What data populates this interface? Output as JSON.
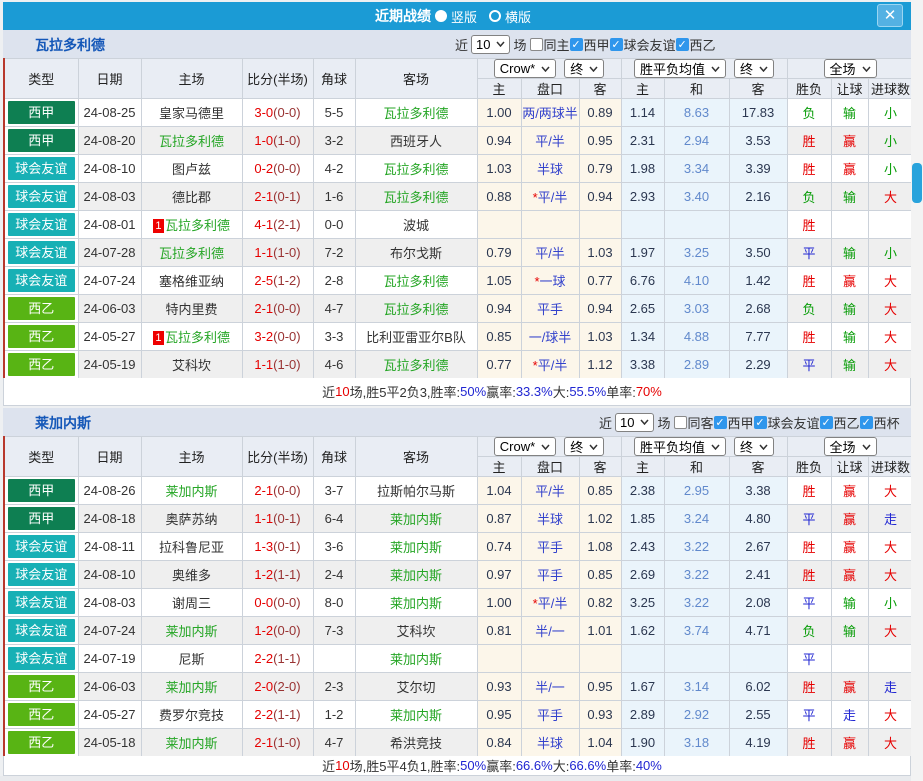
{
  "titlebar": {
    "title": "近期战绩",
    "options": [
      {
        "label": "竖版",
        "selected": true
      },
      {
        "label": "横版",
        "selected": false
      }
    ],
    "close": "✕"
  },
  "dropdowns": {
    "odds_source": "Crow*",
    "odds_time": "终",
    "avg": "胜平负均值",
    "avg_time": "终",
    "scope": "全场"
  },
  "columns": {
    "type": "类型",
    "date": "日期",
    "home": "主场",
    "score": "比分(半场)",
    "corners": "角球",
    "away": "客场",
    "home_odds": "主",
    "handicap": "盘口",
    "away_odds": "客",
    "avg_home": "主",
    "avg_draw": "和",
    "avg_away": "客",
    "result": "胜负",
    "let": "让球",
    "goals": "进球数"
  },
  "league_colors": {
    "西甲": "#0e7f52",
    "球会友谊": "#17b0b5",
    "西乙": "#58b414"
  },
  "status_classes": {
    "胜": "t-red",
    "平": "t-blue",
    "负": "t-green",
    "赢": "t-red",
    "输": "t-green",
    "走": "t-blue",
    "大": "t-red",
    "小": "t-green"
  },
  "appearance": {
    "titlebar_bg": "#1b9bd5",
    "filter_bg": "#dde3ee",
    "accent_blue": "#2f96ec",
    "crow_bg": "#fcf6ea",
    "avg_bg": "#eaf4fb"
  },
  "sections": [
    {
      "team": "瓦拉多利德",
      "filter": {
        "near": "近",
        "count": "10",
        "unit": "场",
        "checkboxes": [
          {
            "label": "同主",
            "checked": false
          },
          {
            "label": "西甲",
            "checked": true
          },
          {
            "label": "球会友谊",
            "checked": true
          },
          {
            "label": "西乙",
            "checked": true
          }
        ]
      },
      "rows": [
        {
          "l": "西甲",
          "d": "24-08-25",
          "h": "皇家马德里",
          "hs": false,
          "hm": "",
          "s": "3-0",
          "sh": "(0-0)",
          "c": "5-5",
          "a": "瓦拉多利德",
          "as": true,
          "am": "",
          "o1": "1.00",
          "o2": "两/两球半",
          "o3": "0.89",
          "m1": "1.14",
          "m2": "8.63",
          "m3": "17.83",
          "r": "负",
          "rl": "输",
          "g": "小"
        },
        {
          "l": "西甲",
          "d": "24-08-20",
          "h": "瓦拉多利德",
          "hs": true,
          "hm": "",
          "s": "1-0",
          "sh": "(1-0)",
          "c": "3-2",
          "a": "西班牙人",
          "as": false,
          "am": "",
          "o1": "0.94",
          "o2": "平/半",
          "o3": "0.95",
          "m1": "2.31",
          "m2": "2.94",
          "m3": "3.53",
          "r": "胜",
          "rl": "赢",
          "g": "小"
        },
        {
          "l": "球会友谊",
          "d": "24-08-10",
          "h": "图卢兹",
          "hs": false,
          "hm": "",
          "s": "0-2",
          "sh": "(0-0)",
          "c": "4-2",
          "a": "瓦拉多利德",
          "as": true,
          "am": "",
          "o1": "1.03",
          "o2": "半球",
          "o3": "0.79",
          "m1": "1.98",
          "m2": "3.34",
          "m3": "3.39",
          "r": "胜",
          "rl": "赢",
          "g": "小"
        },
        {
          "l": "球会友谊",
          "d": "24-08-03",
          "h": "德比郡",
          "hs": false,
          "hm": "",
          "s": "2-1",
          "sh": "(0-1)",
          "c": "1-6",
          "a": "瓦拉多利德",
          "as": true,
          "am": "",
          "o1": "0.88",
          "o2": "*平/半",
          "o3": "0.94",
          "m1": "2.93",
          "m2": "3.40",
          "m3": "2.16",
          "r": "负",
          "rl": "输",
          "g": "大"
        },
        {
          "l": "球会友谊",
          "d": "24-08-01",
          "h": "瓦拉多利德",
          "hs": true,
          "hm": "1",
          "s": "4-1",
          "sh": "(2-1)",
          "c": "0-0",
          "a": "波城",
          "as": false,
          "am": "",
          "o1": "",
          "o2": "",
          "o3": "",
          "m1": "",
          "m2": "",
          "m3": "",
          "r": "胜",
          "rl": "",
          "g": ""
        },
        {
          "l": "球会友谊",
          "d": "24-07-28",
          "h": "瓦拉多利德",
          "hs": true,
          "hm": "",
          "s": "1-1",
          "sh": "(1-0)",
          "c": "7-2",
          "a": "布尔戈斯",
          "as": false,
          "am": "",
          "o1": "0.79",
          "o2": "平/半",
          "o3": "1.03",
          "m1": "1.97",
          "m2": "3.25",
          "m3": "3.50",
          "r": "平",
          "rl": "输",
          "g": "小"
        },
        {
          "l": "球会友谊",
          "d": "24-07-24",
          "h": "塞格维亚纳",
          "hs": false,
          "hm": "",
          "s": "2-5",
          "sh": "(1-2)",
          "c": "2-8",
          "a": "瓦拉多利德",
          "as": true,
          "am": "",
          "o1": "1.05",
          "o2": "*一球",
          "o3": "0.77",
          "m1": "6.76",
          "m2": "4.10",
          "m3": "1.42",
          "r": "胜",
          "rl": "赢",
          "g": "大"
        },
        {
          "l": "西乙",
          "d": "24-06-03",
          "h": "特内里费",
          "hs": false,
          "hm": "",
          "s": "2-1",
          "sh": "(0-0)",
          "c": "4-7",
          "a": "瓦拉多利德",
          "as": true,
          "am": "",
          "o1": "0.94",
          "o2": "平手",
          "o3": "0.94",
          "m1": "2.65",
          "m2": "3.03",
          "m3": "2.68",
          "r": "负",
          "rl": "输",
          "g": "大"
        },
        {
          "l": "西乙",
          "d": "24-05-27",
          "h": "瓦拉多利德",
          "hs": true,
          "hm": "1",
          "s": "3-2",
          "sh": "(0-0)",
          "c": "3-3",
          "a": "比利亚雷亚尔B队",
          "as": false,
          "am": "",
          "o1": "0.85",
          "o2": "一/球半",
          "o3": "1.03",
          "m1": "1.34",
          "m2": "4.88",
          "m3": "7.77",
          "r": "胜",
          "rl": "输",
          "g": "大"
        },
        {
          "l": "西乙",
          "d": "24-05-19",
          "h": "艾科坎",
          "hs": false,
          "hm": "",
          "s": "1-1",
          "sh": "(1-0)",
          "c": "4-6",
          "a": "瓦拉多利德",
          "as": true,
          "am": "",
          "o1": "0.77",
          "o2": "*平/半",
          "o3": "1.12",
          "m1": "3.38",
          "m2": "2.89",
          "m3": "2.29",
          "r": "平",
          "rl": "输",
          "g": "大"
        }
      ],
      "summary": [
        {
          "t": "近",
          "c": "k"
        },
        {
          "t": "10",
          "c": "r"
        },
        {
          "t": "场,胜5平2负3, ",
          "c": "k"
        },
        {
          "t": "胜率:",
          "c": "k"
        },
        {
          "t": "50%",
          "c": "b"
        },
        {
          "t": " 赢率:",
          "c": "k"
        },
        {
          "t": "33.3%",
          "c": "b"
        },
        {
          "t": " 大:",
          "c": "k"
        },
        {
          "t": "55.5%",
          "c": "b"
        },
        {
          "t": " 单率:",
          "c": "k"
        },
        {
          "t": "70%",
          "c": "r"
        }
      ]
    },
    {
      "team": "莱加内斯",
      "filter": {
        "near": "近",
        "count": "10",
        "unit": "场",
        "checkboxes": [
          {
            "label": "同客",
            "checked": false
          },
          {
            "label": "西甲",
            "checked": true
          },
          {
            "label": "球会友谊",
            "checked": true
          },
          {
            "label": "西乙",
            "checked": true
          },
          {
            "label": "西杯",
            "checked": true
          }
        ]
      },
      "rows": [
        {
          "l": "西甲",
          "d": "24-08-26",
          "h": "莱加内斯",
          "hs": true,
          "hm": "",
          "s": "2-1",
          "sh": "(0-0)",
          "c": "3-7",
          "a": "拉斯帕尔马斯",
          "as": false,
          "am": "",
          "o1": "1.04",
          "o2": "平/半",
          "o3": "0.85",
          "m1": "2.38",
          "m2": "2.95",
          "m3": "3.38",
          "r": "胜",
          "rl": "赢",
          "g": "大"
        },
        {
          "l": "西甲",
          "d": "24-08-18",
          "h": "奥萨苏纳",
          "hs": false,
          "hm": "",
          "s": "1-1",
          "sh": "(0-1)",
          "c": "6-4",
          "a": "莱加内斯",
          "as": true,
          "am": "",
          "o1": "0.87",
          "o2": "半球",
          "o3": "1.02",
          "m1": "1.85",
          "m2": "3.24",
          "m3": "4.80",
          "r": "平",
          "rl": "赢",
          "g": "走"
        },
        {
          "l": "球会友谊",
          "d": "24-08-11",
          "h": "拉科鲁尼亚",
          "hs": false,
          "hm": "",
          "s": "1-3",
          "sh": "(0-1)",
          "c": "3-6",
          "a": "莱加内斯",
          "as": true,
          "am": "",
          "o1": "0.74",
          "o2": "平手",
          "o3": "1.08",
          "m1": "2.43",
          "m2": "3.22",
          "m3": "2.67",
          "r": "胜",
          "rl": "赢",
          "g": "大"
        },
        {
          "l": "球会友谊",
          "d": "24-08-10",
          "h": "奥维多",
          "hs": false,
          "hm": "",
          "s": "1-2",
          "sh": "(1-1)",
          "c": "2-4",
          "a": "莱加内斯",
          "as": true,
          "am": "",
          "o1": "0.97",
          "o2": "平手",
          "o3": "0.85",
          "m1": "2.69",
          "m2": "3.22",
          "m3": "2.41",
          "r": "胜",
          "rl": "赢",
          "g": "大"
        },
        {
          "l": "球会友谊",
          "d": "24-08-03",
          "h": "谢周三",
          "hs": false,
          "hm": "",
          "s": "0-0",
          "sh": "(0-0)",
          "c": "8-0",
          "a": "莱加内斯",
          "as": true,
          "am": "",
          "o1": "1.00",
          "o2": "*平/半",
          "o3": "0.82",
          "m1": "3.25",
          "m2": "3.22",
          "m3": "2.08",
          "r": "平",
          "rl": "输",
          "g": "小"
        },
        {
          "l": "球会友谊",
          "d": "24-07-24",
          "h": "莱加内斯",
          "hs": true,
          "hm": "",
          "s": "1-2",
          "sh": "(0-0)",
          "c": "7-3",
          "a": "艾科坎",
          "as": false,
          "am": "",
          "o1": "0.81",
          "o2": "半/一",
          "o3": "1.01",
          "m1": "1.62",
          "m2": "3.74",
          "m3": "4.71",
          "r": "负",
          "rl": "输",
          "g": "大"
        },
        {
          "l": "球会友谊",
          "d": "24-07-19",
          "h": "尼斯",
          "hs": false,
          "hm": "",
          "s": "2-2",
          "sh": "(1-1)",
          "c": "",
          "a": "莱加内斯",
          "as": true,
          "am": "",
          "o1": "",
          "o2": "",
          "o3": "",
          "m1": "",
          "m2": "",
          "m3": "",
          "r": "平",
          "rl": "",
          "g": ""
        },
        {
          "l": "西乙",
          "d": "24-06-03",
          "h": "莱加内斯",
          "hs": true,
          "hm": "",
          "s": "2-0",
          "sh": "(2-0)",
          "c": "2-3",
          "a": "艾尔切",
          "as": false,
          "am": "",
          "o1": "0.93",
          "o2": "半/一",
          "o3": "0.95",
          "m1": "1.67",
          "m2": "3.14",
          "m3": "6.02",
          "r": "胜",
          "rl": "赢",
          "g": "走"
        },
        {
          "l": "西乙",
          "d": "24-05-27",
          "h": "费罗尔竞技",
          "hs": false,
          "hm": "",
          "s": "2-2",
          "sh": "(1-1)",
          "c": "1-2",
          "a": "莱加内斯",
          "as": true,
          "am": "",
          "o1": "0.95",
          "o2": "平手",
          "o3": "0.93",
          "m1": "2.89",
          "m2": "2.92",
          "m3": "2.55",
          "r": "平",
          "rl": "走",
          "g": "大"
        },
        {
          "l": "西乙",
          "d": "24-05-18",
          "h": "莱加内斯",
          "hs": true,
          "hm": "",
          "s": "2-1",
          "sh": "(1-0)",
          "c": "4-7",
          "a": "希洪竞技",
          "as": false,
          "am": "",
          "o1": "0.84",
          "o2": "半球",
          "o3": "1.04",
          "m1": "1.90",
          "m2": "3.18",
          "m3": "4.19",
          "r": "胜",
          "rl": "赢",
          "g": "大"
        }
      ],
      "summary": [
        {
          "t": "近",
          "c": "k"
        },
        {
          "t": "10",
          "c": "r"
        },
        {
          "t": "场,胜5平4负1, ",
          "c": "k"
        },
        {
          "t": "胜率:",
          "c": "k"
        },
        {
          "t": "50%",
          "c": "b"
        },
        {
          "t": " 赢率:",
          "c": "k"
        },
        {
          "t": "66.6%",
          "c": "b"
        },
        {
          "t": " 大:",
          "c": "k"
        },
        {
          "t": "66.6%",
          "c": "b"
        },
        {
          "t": " 单率:",
          "c": "k"
        },
        {
          "t": "40%",
          "c": "b"
        }
      ]
    }
  ]
}
